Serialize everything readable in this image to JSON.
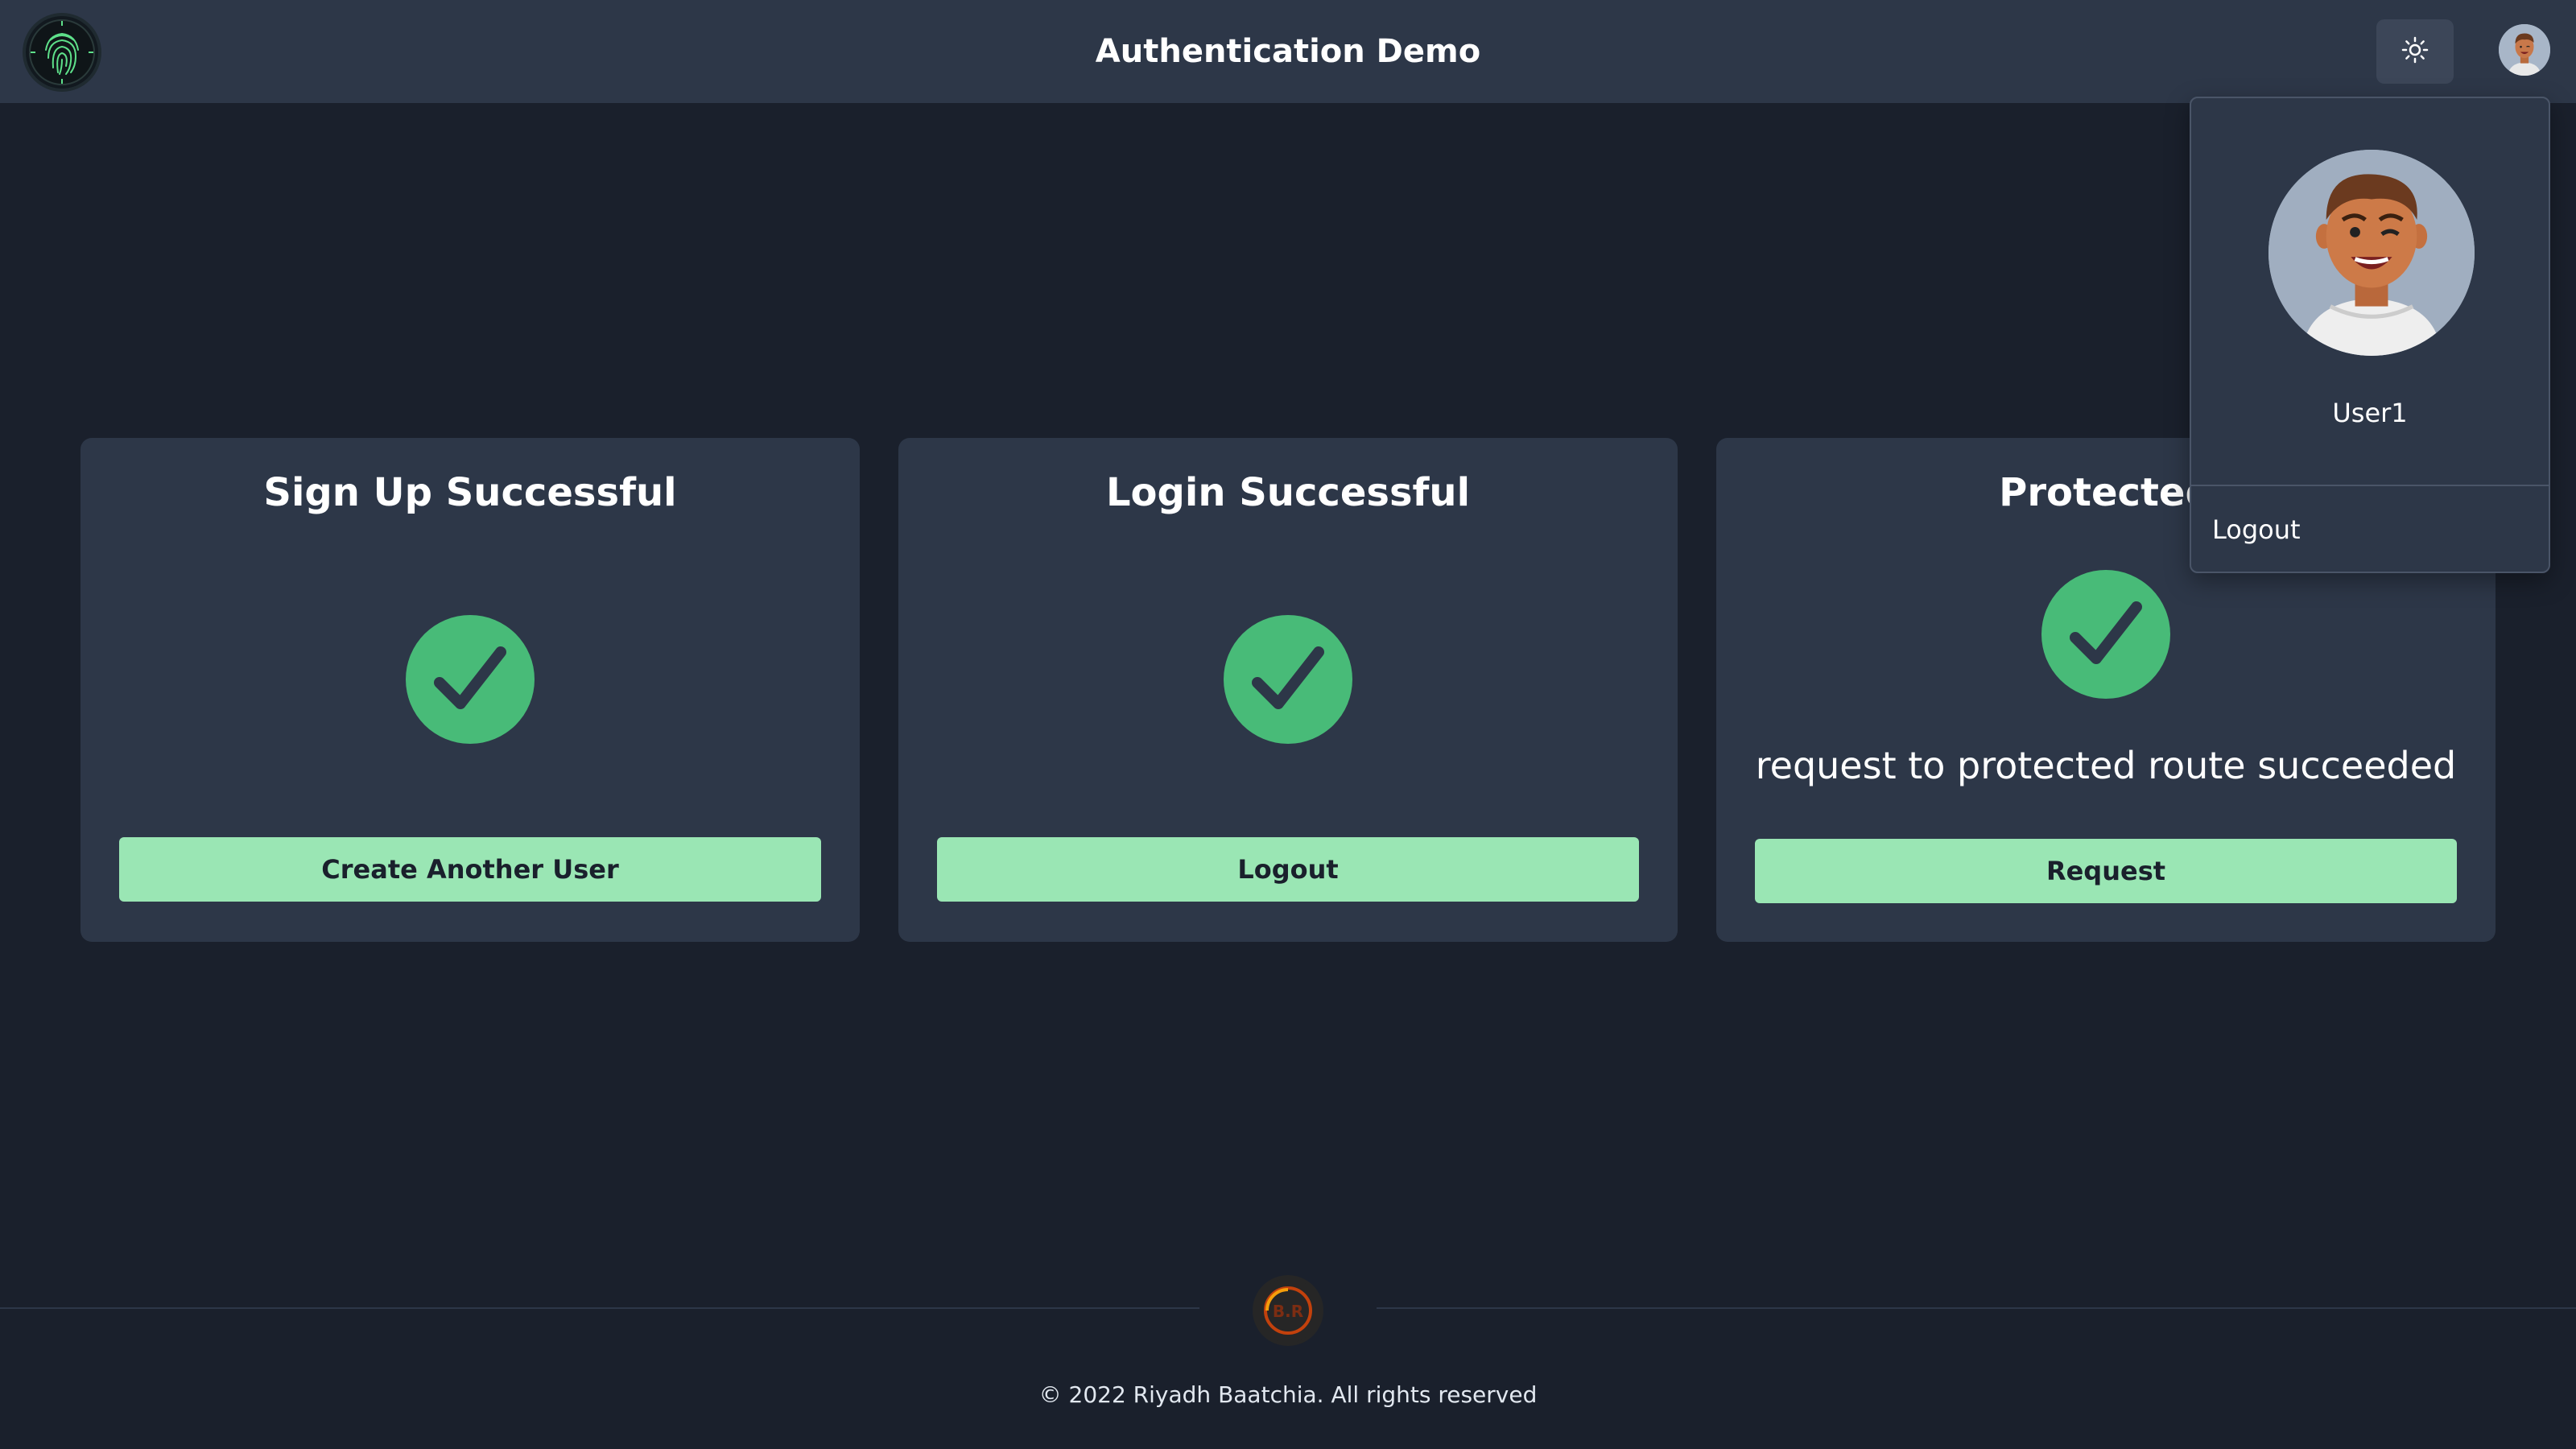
{
  "header": {
    "title": "Authentication Demo",
    "logo_icon": "fingerprint-icon",
    "theme_toggle_icon": "sun-icon"
  },
  "cards": [
    {
      "title": "Sign Up Successful",
      "status_icon": "check-circle-icon",
      "button_label": "Create Another User"
    },
    {
      "title": "Login Successful",
      "status_icon": "check-circle-icon",
      "button_label": "Logout"
    },
    {
      "title": "Protected",
      "status_icon": "check-circle-icon",
      "message": "request to protected route succeeded",
      "button_label": "Request"
    }
  ],
  "user_menu": {
    "username": "User1",
    "logout_label": "Logout"
  },
  "footer": {
    "logo_text": "B.R",
    "copyright": "© 2022 Riyadh Baatchia. All rights reserved"
  },
  "colors": {
    "background": "#1a202c",
    "surface": "#2d3748",
    "success": "#48bb78",
    "button": "#9ae6b4",
    "accent_logo": "#4ade80"
  }
}
